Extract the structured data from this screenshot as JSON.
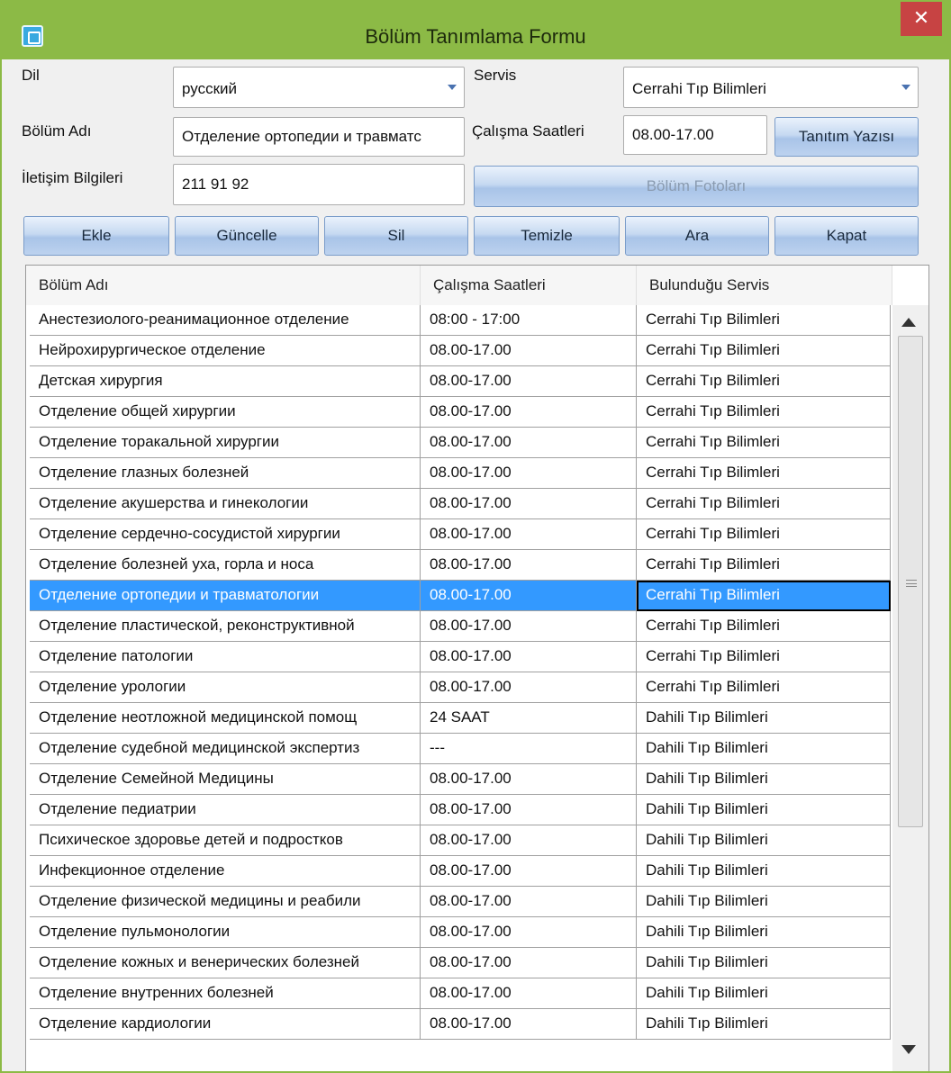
{
  "window": {
    "title": "Bölüm Tanımlama Formu",
    "close_glyph": "✕"
  },
  "form": {
    "dil_label": "Dil",
    "dil_value": "русский",
    "servis_label": "Servis",
    "servis_value": "Cerrahi Tıp Bilimleri",
    "bolum_adi_label": "Bölüm Adı",
    "bolum_adi_value": "Отделение ортопедии и травматс",
    "calisma_label": "Çalışma Saatleri",
    "calisma_value": "08.00-17.00",
    "tanitim_button": "Tanıtım Yazısı",
    "iletisim_label": "İletişim Bilgileri",
    "iletisim_value": "211 91 92",
    "fotolar_button": "Bölüm Fotoları"
  },
  "toolbar": {
    "ekle": "Ekle",
    "guncelle": "Güncelle",
    "sil": "Sil",
    "temizle": "Temizle",
    "ara": "Ara",
    "kapat": "Kapat"
  },
  "grid": {
    "columns": [
      "Bölüm Adı",
      "Çalışma Saatleri",
      "Bulunduğu Servis"
    ],
    "selected_row": 9,
    "rows": [
      [
        "Анестезиолого-реанимационное отделение",
        "08:00 - 17:00",
        "Cerrahi Tıp Bilimleri"
      ],
      [
        "Нейрохирургическое отделение",
        "08.00-17.00",
        "Cerrahi Tıp Bilimleri"
      ],
      [
        "Детская хирургия",
        "08.00-17.00",
        "Cerrahi Tıp Bilimleri"
      ],
      [
        "Отделение общей хирургии",
        "08.00-17.00",
        "Cerrahi Tıp Bilimleri"
      ],
      [
        "Отделение торакальной хирургии",
        "08.00-17.00",
        "Cerrahi Tıp Bilimleri"
      ],
      [
        "Отделение глазных болезней",
        "08.00-17.00",
        "Cerrahi Tıp Bilimleri"
      ],
      [
        "Отделение акушерства и гинекологии",
        "08.00-17.00",
        "Cerrahi Tıp Bilimleri"
      ],
      [
        "Отделение сердечно-сосудистой хирургии",
        "08.00-17.00",
        "Cerrahi Tıp Bilimleri"
      ],
      [
        "Отделение болезней уха, горла и носа",
        "08.00-17.00",
        "Cerrahi Tıp Bilimleri"
      ],
      [
        "Отделение ортопедии и травматологии",
        "08.00-17.00",
        "Cerrahi Tıp Bilimleri"
      ],
      [
        "Отделение пластической, реконструктивной",
        "08.00-17.00",
        "Cerrahi Tıp Bilimleri"
      ],
      [
        "Отделение патологии",
        "08.00-17.00",
        "Cerrahi Tıp Bilimleri"
      ],
      [
        "Отделение урологии",
        "08.00-17.00",
        "Cerrahi Tıp Bilimleri"
      ],
      [
        "Отделение неотложной медицинской помощ",
        "24 SAAT",
        "Dahili Tıp Bilimleri"
      ],
      [
        "Отделение судебной медицинской экспертиз",
        "---",
        "Dahili Tıp Bilimleri"
      ],
      [
        "Отделение Семейной Медицины",
        "08.00-17.00",
        "Dahili Tıp Bilimleri"
      ],
      [
        "Отделение педиатрии",
        "08.00-17.00",
        "Dahili Tıp Bilimleri"
      ],
      [
        "Психическое здоровье детей и подростков",
        "08.00-17.00",
        "Dahili Tıp Bilimleri"
      ],
      [
        "Инфекционное отделение",
        "08.00-17.00",
        "Dahili Tıp Bilimleri"
      ],
      [
        "Отделение физической медицины и реабили",
        "08.00-17.00",
        "Dahili Tıp Bilimleri"
      ],
      [
        "Отделение пульмонологии",
        "08.00-17.00",
        "Dahili Tıp Bilimleri"
      ],
      [
        "Отделение кожных и венерических болезней",
        "08.00-17.00",
        "Dahili Tıp Bilimleri"
      ],
      [
        "Отделение внутренних болезней",
        "08.00-17.00",
        "Dahili Tıp Bilimleri"
      ],
      [
        "Отделение кардиологии",
        "08.00-17.00",
        "Dahili Tıp Bilimleri"
      ]
    ]
  }
}
